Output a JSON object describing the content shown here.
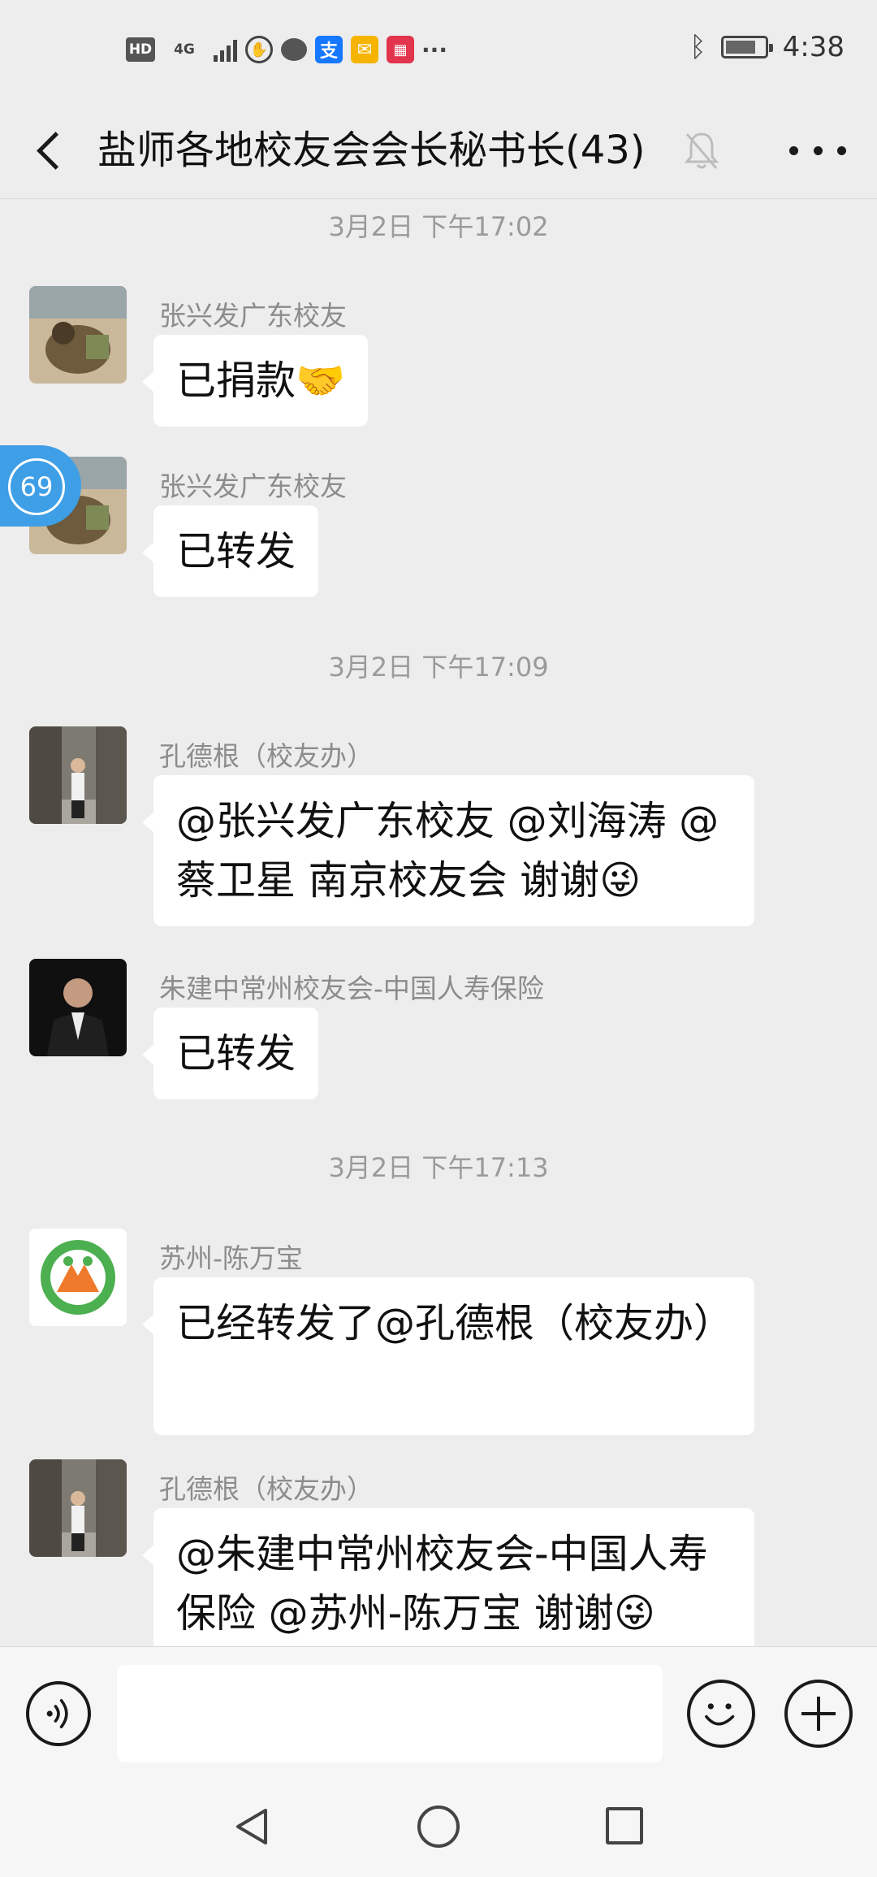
{
  "status_bar": {
    "hd": "HD",
    "network": "4G",
    "alipay": "支",
    "more": "···",
    "time": "4:38"
  },
  "header": {
    "title": "盐师各地校友会会长秘书长(43)"
  },
  "unread_badge": "69",
  "timestamps": [
    "3月2日 下午17:02",
    "3月2日 下午17:09",
    "3月2日 下午17:13"
  ],
  "messages": [
    {
      "sender": "张兴发广东校友",
      "text": "已捐款🤝"
    },
    {
      "sender": "张兴发广东校友",
      "text": "已转发"
    },
    {
      "sender": "孔德根（校友办）",
      "text": "@张兴发广东校友 @刘海涛 @蔡卫星 南京校友会  谢谢😜"
    },
    {
      "sender": "朱建中常州校友会-中国人寿保险",
      "text": "已转发"
    },
    {
      "sender": "苏州-陈万宝",
      "text": "已经转发了@孔德根（校友办）"
    },
    {
      "sender": "孔德根（校友办）",
      "text": "@朱建中常州校友会-中国人寿保险 @苏州-陈万宝  谢谢😜"
    }
  ],
  "input": {
    "value": ""
  }
}
